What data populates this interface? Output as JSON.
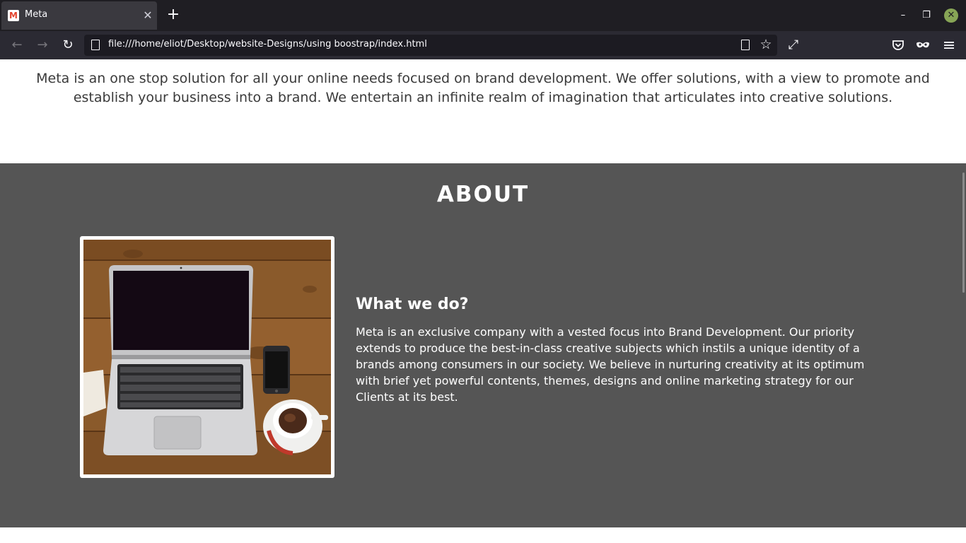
{
  "browser": {
    "tab": {
      "title": "Meta",
      "favicon": "M",
      "close": "✕"
    },
    "new_tab": "+",
    "window": {
      "minimize": "–",
      "maximize": "❐",
      "close": "✕"
    },
    "nav": {
      "back": "←",
      "forward": "→",
      "reload": "↻",
      "url": "file:///home/eliot/Desktop/website-Designs/using boostrap/index.html",
      "bookmark": "☆",
      "expand": "⤢",
      "pocket": "◡",
      "mask": "∞",
      "menu": "≡"
    },
    "icons": {
      "favicon": "gmail-m-icon",
      "page": "page-icon",
      "reader": "reader-view-icon",
      "bookmark": "star-icon",
      "expand": "fullscreen-icon",
      "pocket": "pocket-icon",
      "mask": "private-mask-icon",
      "menu": "hamburger-icon"
    }
  },
  "page": {
    "intro": "Meta is an one stop solution for all your online needs focused on brand development. We offer solutions, with a view to promote and establish your business into a brand. We entertain an infinite realm of imagination that articulates into creative solutions.",
    "about": {
      "title": "ABOUT",
      "heading": "What we do?",
      "text": "Meta is an exclusive company with a vested focus into Brand Development. Our priority extends to produce the best-in-class creative subjects which instils a unique identity of a brands among consumers in our society. We believe in nurturing creativity at its optimum with brief yet powerful contents, themes, designs and online marketing strategy for our Clients at its best.",
      "image": "laptop-on-wooden-desk-with-phone-and-coffee"
    }
  },
  "colors": {
    "about_bg": "#555555",
    "tabbar_bg": "#1f1e23",
    "navbar_bg": "#2b2a33",
    "close_green": "#87a556"
  }
}
